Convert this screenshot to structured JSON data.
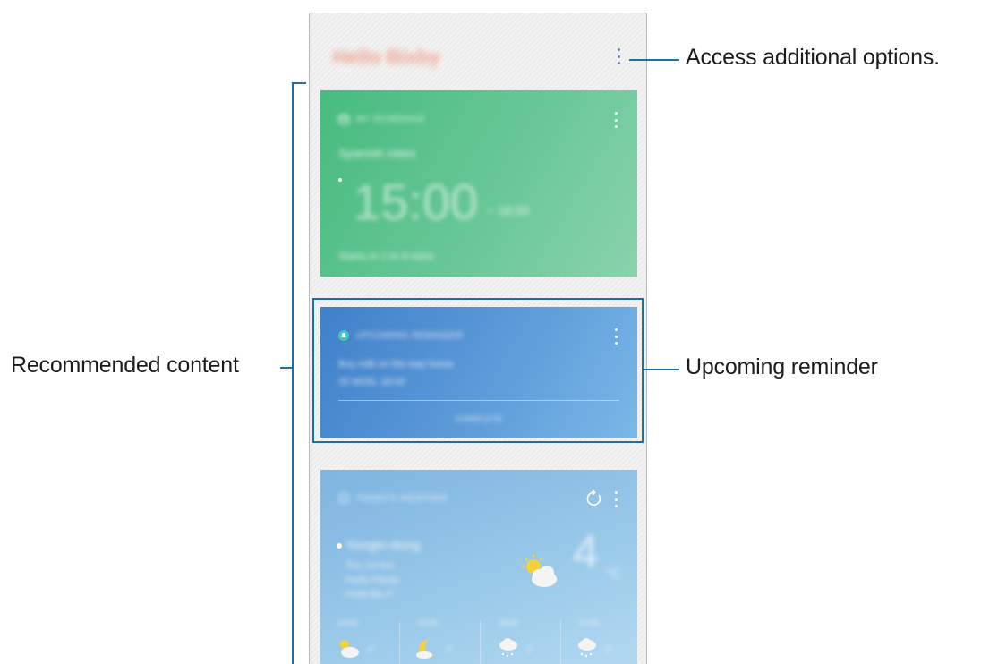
{
  "header": {
    "title": "Hello Bixby",
    "more_icon": "more-vertical-icon"
  },
  "cards": {
    "event": {
      "category": "MY SCHEDULE",
      "name": "Spanish class",
      "time": "15:00",
      "end_time": "~ 16:00",
      "starts_in": "Starts in 1 hr 6 mins",
      "icon": "calendar-icon",
      "color": "#4dbd83"
    },
    "reminder": {
      "category": "UPCOMING REMINDER",
      "text": "Buy milk on the way home",
      "date": "25 MON, 18:00",
      "complete_label": "COMPLETE",
      "icon": "bell-icon",
      "color": "#4a8bd0"
    },
    "weather": {
      "category": "TODAY'S WEATHER",
      "location": "Yongin-dong",
      "line1": "Thu, 14 Nov",
      "line2": "Partly Cloudy",
      "line3": "Feels like 2°",
      "temp": "4",
      "unit": "°C",
      "hours": [
        {
          "time": "14:00",
          "temp": "4°",
          "icon": "partly-cloudy-icon"
        },
        {
          "time": "15:00",
          "temp": "4°",
          "icon": "moon-icon"
        },
        {
          "time": "16:00",
          "temp": "3°",
          "icon": "snow-cloud-icon"
        },
        {
          "time": "17:00",
          "temp": "3°",
          "icon": "snow-cloud-icon"
        }
      ],
      "color": "#86bae2"
    }
  },
  "callouts": {
    "options": "Access additional options.",
    "recommended": "Recommended content",
    "reminder": "Upcoming reminder"
  },
  "colors": {
    "callout_line": "#1d6fa5",
    "highlight_border": "#1a6fa9"
  }
}
